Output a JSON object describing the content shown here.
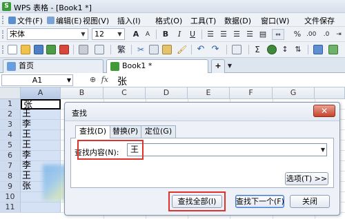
{
  "window": {
    "title": "WPS 表格 - [Book1 *]",
    "app_icon": "S"
  },
  "menubar": {
    "items": [
      "文件(F)",
      "编辑(E)",
      "视图(V)",
      "插入(I)",
      "格式(O)",
      "工具(T)",
      "数据(D)",
      "窗口(W)",
      "文件保存"
    ]
  },
  "format_toolbar": {
    "font_name": "宋体",
    "font_size": "12",
    "bold": "B",
    "italic": "I",
    "underline": "U",
    "grow_font": "A",
    "shrink_font": "A",
    "percent": "%"
  },
  "tabs": {
    "home": "首页",
    "book": "Book1 *",
    "new_tab": "+"
  },
  "formula_bar": {
    "name_box": "A1",
    "fx": "fx",
    "value": "张"
  },
  "sheet": {
    "columns": [
      "A",
      "B",
      "C",
      "D",
      "E",
      "F",
      "G"
    ],
    "rows": [
      "1",
      "2",
      "3",
      "4",
      "5",
      "6",
      "7",
      "8",
      "9",
      "10",
      "11"
    ],
    "col_a_values": [
      "张",
      "王",
      "李",
      "王",
      "王",
      "李",
      "李",
      "王",
      "张",
      "",
      ""
    ]
  },
  "find_dialog": {
    "title": "查找",
    "tabs": [
      "查找(D)",
      "替换(P)",
      "定位(G)"
    ],
    "find_label": "查找内容(N):",
    "find_value": "王",
    "options_button": "选项(T) >>",
    "find_all_button": "查找全部(I)",
    "find_next_button": "查找下一个(F)",
    "close_button": "关闭",
    "close_glyph": "✕"
  },
  "colors": {
    "highlight_box": "#e0312b",
    "selected_column": "#d5e2f5"
  }
}
